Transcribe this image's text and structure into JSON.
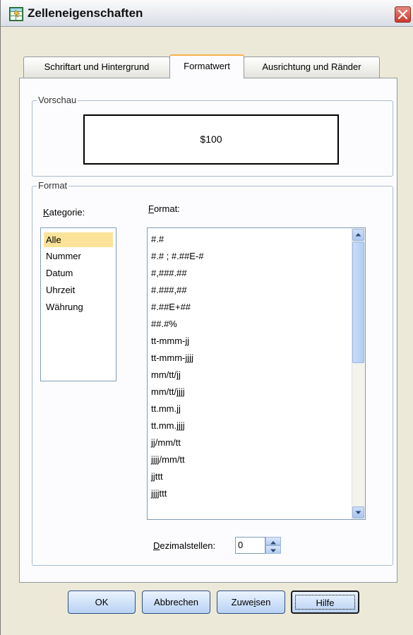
{
  "window": {
    "title": "Zelleneigenschaften",
    "icons": {
      "app": "table-properties-icon",
      "close": "close-icon"
    }
  },
  "tabs": [
    {
      "label": "Schriftart und Hintergrund",
      "active": false
    },
    {
      "label": "Formatwert",
      "active": true
    },
    {
      "label": "Ausrichtung und Ränder",
      "active": false
    }
  ],
  "preview": {
    "legend": "Vorschau",
    "value": "$100"
  },
  "format_group": {
    "legend": "Format",
    "category_label_prefix": "K",
    "category_label_rest": "ategorie:",
    "format_label_prefix": "F",
    "format_label_rest": "ormat:",
    "categories": [
      {
        "label": "Alle",
        "selected": true
      },
      {
        "label": "Nummer",
        "selected": false
      },
      {
        "label": "Datum",
        "selected": false
      },
      {
        "label": "Uhrzeit",
        "selected": false
      },
      {
        "label": "Währung",
        "selected": false
      }
    ],
    "formats": [
      "#.#",
      "#.# ; #.##E-#",
      "#,###.##",
      "#.###,##",
      "#.##E+##",
      "##.#%",
      "tt-mmm-jj",
      "tt-mmm-jjjj",
      "mm/tt/jj",
      "mm/tt/jjjj",
      "tt.mm.jj",
      "tt.mm.jjjj",
      "jj/mm/tt",
      "jjjj/mm/tt",
      "jjttt",
      "jjjjttt"
    ],
    "decimal_label_prefix": "D",
    "decimal_label_rest": "ezimalstellen:",
    "decimal_value": "0"
  },
  "buttons": {
    "ok": "OK",
    "cancel": "Abbrechen",
    "apply_prefix": "Zuwe",
    "apply_accel": "i",
    "apply_rest": "sen",
    "help": "Hilfe"
  },
  "colors": {
    "selection": "#fbe39a",
    "active_tab_accent": "#f5b24a",
    "button_gradient_bottom": "#b9d2f3"
  }
}
